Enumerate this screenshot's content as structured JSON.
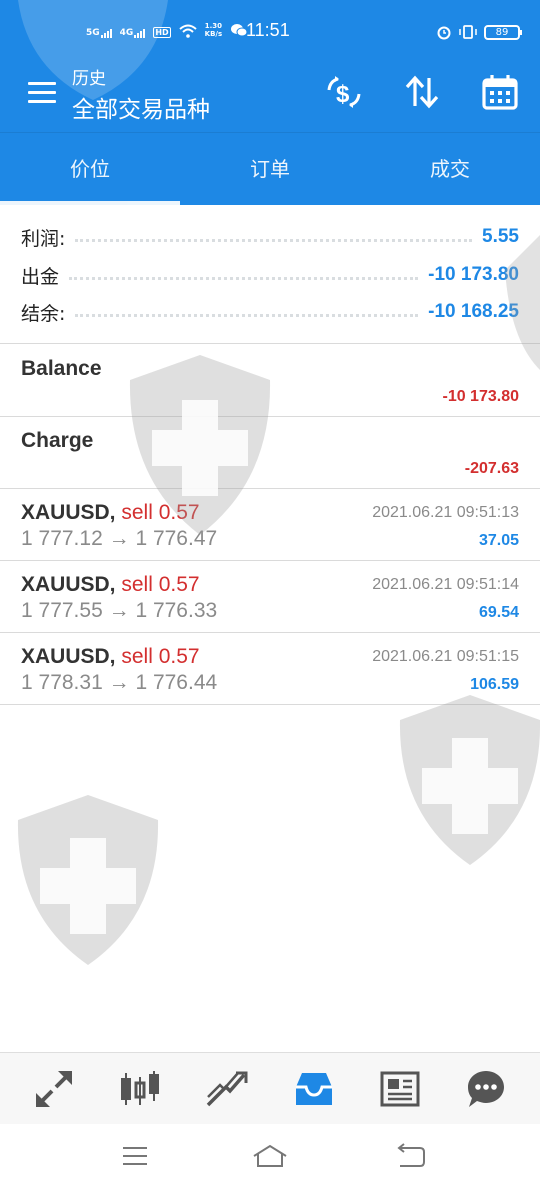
{
  "status_bar": {
    "network_1": "5G",
    "network_2": "4G",
    "hd": "HD",
    "speed_value": "1.30",
    "speed_unit": "KB/s",
    "time": "11:51",
    "battery": "89"
  },
  "toolbar": {
    "title": "历史",
    "subtitle": "全部交易品种",
    "icons": [
      "menu-icon",
      "currency-exchange-icon",
      "sort-icon",
      "calendar-icon"
    ]
  },
  "tabs": [
    {
      "label": "价位",
      "active": true
    },
    {
      "label": "订单",
      "active": false
    },
    {
      "label": "成交",
      "active": false
    }
  ],
  "summary": {
    "profit_label": "利润:",
    "profit_value": "5.55",
    "withdrawal_label": "出金",
    "withdrawal_value": "-10 173.80",
    "balance_label": "结余:",
    "balance_value": "-10 168.25"
  },
  "entries": [
    {
      "title": "Balance",
      "value": "-10 173.80"
    },
    {
      "title": "Charge",
      "value": "-207.63"
    }
  ],
  "deals": [
    {
      "symbol": "XAUUSD,",
      "side": "sell 0.57",
      "open": "1 777.12",
      "arrow": "→",
      "close": "1 776.47",
      "time": "2021.06.21 09:51:13",
      "profit": "37.05"
    },
    {
      "symbol": "XAUUSD,",
      "side": "sell 0.57",
      "open": "1 777.55",
      "arrow": "→",
      "close": "1 776.33",
      "time": "2021.06.21 09:51:14",
      "profit": "69.54"
    },
    {
      "symbol": "XAUUSD,",
      "side": "sell 0.57",
      "open": "1 778.31",
      "arrow": "→",
      "close": "1 776.44",
      "time": "2021.06.21 09:51:15",
      "profit": "106.59"
    }
  ],
  "bottom_nav": [
    "quotes-icon",
    "chart-icon",
    "trade-icon",
    "history-icon",
    "news-icon",
    "chat-icon"
  ],
  "active_nav": "history-icon",
  "colors": {
    "accent": "#1e88e5",
    "negative": "#d32f2f",
    "muted": "#8a8a8a"
  }
}
